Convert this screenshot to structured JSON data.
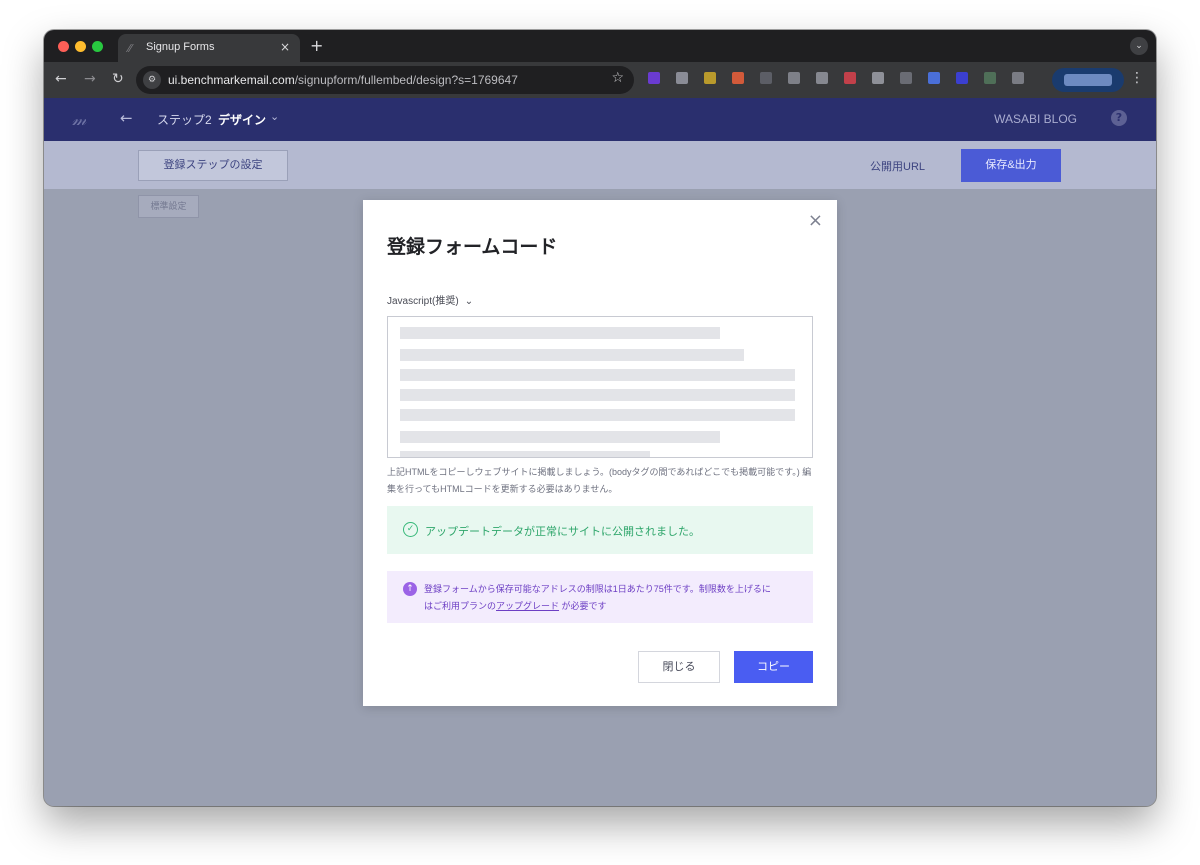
{
  "browser": {
    "tab_title": "Signup Forms",
    "tab_favicon": "benchmark-logo-icon",
    "tab_close_glyph": "×",
    "new_tab_glyph": "+",
    "url_host": "ui.benchmarkemail.com",
    "url_path": "/signupform/fullembed/design?s=1769647",
    "extension_colors": [
      "#6a3bd1",
      "#8a8c96",
      "#b99a2c",
      "#d25a3a",
      "#5c5e66",
      "#7e8088",
      "#868890",
      "#c2404a",
      "#8e9098",
      "#6a6c74",
      "#4a6fd8",
      "#3b3fd0",
      "#4f6f58",
      "#7a7c84"
    ]
  },
  "app": {
    "logo_glyph": "𝓂",
    "back_glyph": "←",
    "step_label": "ステップ2",
    "step_name": "デザイン",
    "step_chevron": "⌄",
    "account_name": "WASABI BLOG",
    "help_glyph": "?"
  },
  "subbar": {
    "settings_button": "登録ステップの設定",
    "public_url_link": "公開用URL",
    "save_button": "保存&出力"
  },
  "canvas": {
    "standard_settings_button": "標準設定"
  },
  "modal": {
    "close_glyph": "×",
    "title": "登録フォームコード",
    "code_type_selected": "Javascript(推奨)",
    "code_type_chevron": "⌄",
    "help_text": "上記HTMLをコピーしウェブサイトに掲載しましょう。(bodyタグの間であればどこでも掲載可能です。) 編集を行ってもHTMLコードを更新する必要はありません。",
    "success_message": "アップデートデータが正常にサイトに公開されました。",
    "upgrade_line1": "登録フォームから保存可能なアドレスの制限は1日あたり75件です。制限数を上げるに",
    "upgrade_line2_prefix": "はご利用プランの",
    "upgrade_link": "アップグレード",
    "upgrade_line2_suffix": "が必要です",
    "close_button": "閉じる",
    "copy_button": "コピー"
  }
}
